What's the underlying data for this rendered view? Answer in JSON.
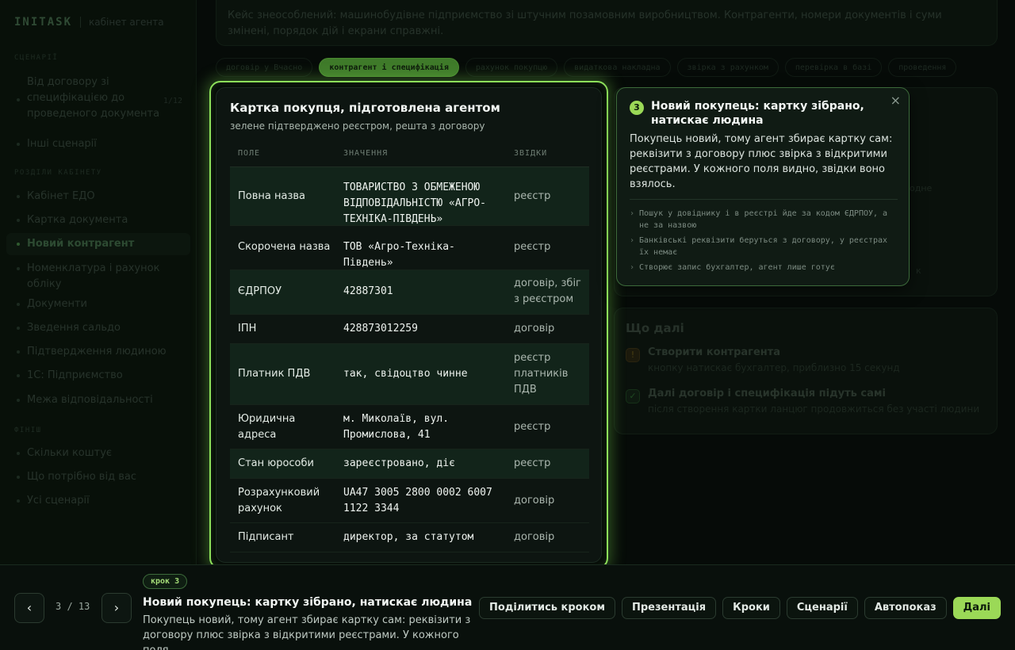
{
  "brand": {
    "name": "INITASK",
    "subtitle": "кабінет агента"
  },
  "sidebar": {
    "sections": [
      "СЦЕНАРІЇ",
      "РОЗДІЛИ КАБІНЕТУ",
      "ФІНІШ"
    ],
    "scenario_items": [
      {
        "label": "Від договору зі специфікацією до проведеного документа",
        "count": "1/12"
      },
      {
        "label": "Інші сценарії"
      }
    ],
    "cabinet_items": [
      {
        "label": "Кабінет ЕДО"
      },
      {
        "label": "Картка документа"
      },
      {
        "label": "Новий контрагент"
      },
      {
        "label": "Номенклатура і рахунок обліку"
      },
      {
        "label": "Документи"
      },
      {
        "label": "Зведення сальдо"
      },
      {
        "label": "Підтвердження людиною"
      },
      {
        "label": "1С: Підприємство"
      },
      {
        "label": "Межа відповідальності"
      }
    ],
    "finish_items": [
      {
        "label": "Скільки коштує"
      },
      {
        "label": "Що потрібно від вас"
      },
      {
        "label": "Усі сценарії"
      }
    ]
  },
  "banner": {
    "text": "Кейс знеособлений: машинобудівне підприємство зі штучним позамовним виробництвом. Контрагенти, номери документів і суми змінені, порядок дій і екрани справжні."
  },
  "tabs": [
    {
      "label": "договір у Вчасно"
    },
    {
      "label": "контрагент і специфікація"
    },
    {
      "label": "рахунок покупцю"
    },
    {
      "label": "видаткова накладна"
    },
    {
      "label": "звірка з рахунком"
    },
    {
      "label": "перевірка в базі"
    },
    {
      "label": "проведення"
    }
  ],
  "whats_next": {
    "title": "Що далі",
    "items": [
      {
        "icon": "!",
        "title": "Створити контрагента",
        "subtitle": "кнопку натискає бухгалтер, приблизно 15 секунд"
      },
      {
        "icon": "✓",
        "title": "Далі договір і специфікація підуть самі",
        "subtitle": "після створення картки ланцюг продовжиться без участі людини"
      }
    ]
  },
  "bg_fragments": [
    "одне",
    "к"
  ],
  "card": {
    "title": "Картка покупця, підготовлена агентом",
    "subtitle": "зелене підтверджено реєстром, решта з договору",
    "columns": [
      "ПОЛЕ",
      "ЗНАЧЕННЯ",
      "ЗВІДКИ"
    ],
    "rows": [
      {
        "field": "Повна назва",
        "value": "ТОВАРИСТВО З ОБМЕЖЕНОЮ ВІДПОВІДАЛЬНІСТЮ «АГРО-ТЕХНІКА-ПІВДЕНЬ»",
        "source": "реєстр",
        "verified": true
      },
      {
        "field": "Скорочена назва",
        "value": "ТОВ «Агро-Техніка-Південь»",
        "source": "реєстр",
        "verified": false
      },
      {
        "field": "ЄДРПОУ",
        "value": "42887301",
        "source": "договір, збіг з реєстром",
        "verified": true
      },
      {
        "field": "ІПН",
        "value": "428873012259",
        "source": "договір",
        "verified": false
      },
      {
        "field": "Платник ПДВ",
        "value": "так, свідоцтво чинне",
        "source": "реєстр платників ПДВ",
        "verified": true
      },
      {
        "field": "Юридична адреса",
        "value": "м. Миколаїв, вул. Промислова, 41",
        "source": "реєстр",
        "verified": false
      },
      {
        "field": "Стан юрособи",
        "value": "зареєстровано, діє",
        "source": "реєстр",
        "verified": true
      },
      {
        "field": "Розрахунковий рахунок",
        "value": "UA47 3005 2800 0002 6007 1122 3344",
        "source": "договір",
        "verified": false
      },
      {
        "field": "Підписант",
        "value": "директор, за статутом",
        "source": "договір",
        "verified": false
      }
    ]
  },
  "tooltip": {
    "number": "3",
    "title": "Новий покупець: картку зібрано, натискає людина",
    "close": "×",
    "body": "Покупець новий, тому агент збирає картку сам: реквізити з договору плюс звірка з відкритими реєстрами. У кожного поля видно, звідки воно взялось.",
    "bullets": [
      "Пошук у довіднику і в реєстрі йде за кодом ЄДРПОУ, а не за назвою",
      "Банківські реквізити беруться з договору, у реєстрах їх немає",
      "Створює запис бухгалтер, агент лише готує"
    ]
  },
  "bottom": {
    "prev": "‹",
    "next": "›",
    "step_counter": "3 / 13",
    "badge": "крок 3",
    "title": "Новий покупець: картку зібрано, натискає людина",
    "description": "Покупець новий, тому агент збирає картку сам: реквізити з договору плюс звірка з відкритими реєстрами. У кожного поля...",
    "actions": [
      "Поділитись кроком",
      "Презентація",
      "Кроки",
      "Сценарії",
      "Автопоказ"
    ],
    "primary_action": "Далі"
  },
  "colors": {
    "accent": "#9bd957",
    "focus_ring": "#8de05a",
    "background": "#060b08"
  }
}
